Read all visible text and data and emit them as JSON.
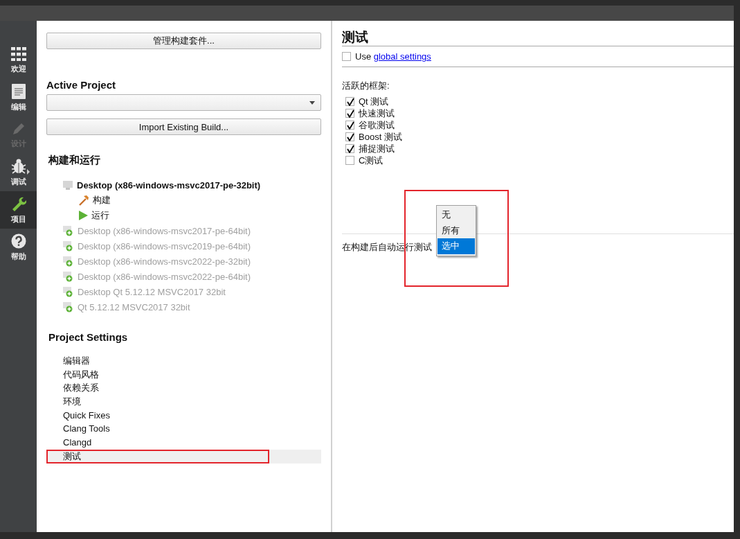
{
  "sidebar": {
    "items": [
      {
        "label": "欢迎",
        "selected": false,
        "disabled": false,
        "has_submenu": false
      },
      {
        "label": "编辑",
        "selected": false,
        "disabled": false,
        "has_submenu": false
      },
      {
        "label": "设计",
        "selected": false,
        "disabled": true,
        "has_submenu": false
      },
      {
        "label": "调试",
        "selected": false,
        "disabled": false,
        "has_submenu": true
      },
      {
        "label": "项目",
        "selected": true,
        "disabled": false,
        "has_submenu": false
      },
      {
        "label": "帮助",
        "selected": false,
        "disabled": false,
        "has_submenu": false
      }
    ]
  },
  "left_panel": {
    "manage_kits_button": "管理构建套件...",
    "active_project": {
      "heading": "Active Project"
    },
    "import_button": "Import Existing Build...",
    "build_run": {
      "heading": "构建和运行",
      "kits": [
        {
          "label": "Desktop (x86-windows-msvc2017-pe-32bit)",
          "enabled": true,
          "children": [
            {
              "label": "构建",
              "kind": "build"
            },
            {
              "label": "运行",
              "kind": "run"
            }
          ]
        },
        {
          "label": "Desktop (x86-windows-msvc2017-pe-64bit)",
          "enabled": false
        },
        {
          "label": "Desktop (x86-windows-msvc2019-pe-64bit)",
          "enabled": false
        },
        {
          "label": "Desktop (x86-windows-msvc2022-pe-32bit)",
          "enabled": false
        },
        {
          "label": "Desktop (x86-windows-msvc2022-pe-64bit)",
          "enabled": false
        },
        {
          "label": "Desktop Qt 5.12.12 MSVC2017 32bit",
          "enabled": false
        },
        {
          "label": "Qt 5.12.12 MSVC2017 32bit",
          "enabled": false
        }
      ]
    },
    "project_settings": {
      "heading": "Project Settings",
      "items": [
        {
          "label": "编辑器",
          "selected": false,
          "highlighted": false
        },
        {
          "label": "代码风格",
          "selected": false,
          "highlighted": false
        },
        {
          "label": "依赖关系",
          "selected": false,
          "highlighted": false
        },
        {
          "label": "环境",
          "selected": false,
          "highlighted": false
        },
        {
          "label": "Quick Fixes",
          "selected": false,
          "highlighted": false
        },
        {
          "label": "Clang Tools",
          "selected": false,
          "highlighted": false
        },
        {
          "label": "Clangd",
          "selected": false,
          "highlighted": false
        },
        {
          "label": "测试",
          "selected": true,
          "highlighted": true
        }
      ]
    }
  },
  "right_panel": {
    "title": "测试",
    "global_settings": {
      "checked": false,
      "prefix": "Use",
      "link": "global settings"
    },
    "frameworks": {
      "label": "活跃的框架:",
      "items": [
        {
          "label": "Qt 测试",
          "checked": true
        },
        {
          "label": "快速测试",
          "checked": true
        },
        {
          "label": "谷歌测试",
          "checked": true
        },
        {
          "label": "Boost 测试",
          "checked": true
        },
        {
          "label": "捕捉测试",
          "checked": true
        },
        {
          "label": "C测试",
          "checked": false
        }
      ]
    },
    "run_after_build": {
      "label": "在构建后自动运行测试",
      "highlighted": true,
      "options": [
        {
          "label": "无",
          "selected": false
        },
        {
          "label": "所有",
          "selected": false
        },
        {
          "label": "选中",
          "selected": true
        }
      ]
    }
  }
}
